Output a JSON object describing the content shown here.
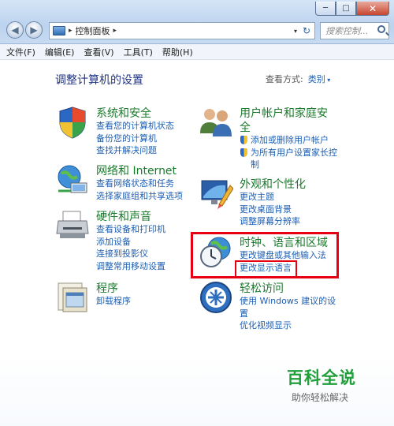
{
  "window": {
    "buttons": {
      "minimize": "─",
      "maximize": "□",
      "close": "✕"
    }
  },
  "nav": {
    "back": "◀",
    "forward": "▶"
  },
  "address": {
    "crumbs": [
      "控制面板"
    ],
    "separator": "▸",
    "dropdown": "▾",
    "refresh": "↻"
  },
  "search": {
    "placeholder": "搜索控制..."
  },
  "menu": [
    "文件(F)",
    "编辑(E)",
    "查看(V)",
    "工具(T)",
    "帮助(H)"
  ],
  "page": {
    "heading": "调整计算机的设置",
    "view_by_label": "查看方式:",
    "view_by_value": "类别"
  },
  "categories": {
    "system": {
      "title": "系统和安全",
      "links": [
        "查看您的计算机状态",
        "备份您的计算机",
        "查找并解决问题"
      ]
    },
    "network": {
      "title": "网络和 Internet",
      "links": [
        "查看网络状态和任务",
        "选择家庭组和共享选项"
      ]
    },
    "hardware": {
      "title": "硬件和声音",
      "links": [
        "查看设备和打印机",
        "添加设备",
        "连接到投影仪",
        "调整常用移动设置"
      ]
    },
    "programs": {
      "title": "程序",
      "links": [
        "卸载程序"
      ]
    },
    "users": {
      "title_line1": "用户帐户和家庭安",
      "title_line2": "全",
      "links": [
        "添加或删除用户帐户",
        "为所有用户设置家长控",
        "制"
      ]
    },
    "appearance": {
      "title": "外观和个性化",
      "links": [
        "更改主题",
        "更改桌面背景",
        "调整屏幕分辨率"
      ]
    },
    "clock": {
      "title": "时钟、语言和区域",
      "links": [
        "更改键盘或其他输入法",
        "更改显示语言"
      ]
    },
    "ease": {
      "title": "轻松访问",
      "links": [
        "使用 Windows 建议的设",
        "置",
        "优化视频显示"
      ]
    }
  },
  "watermark": {
    "title": "百科全说",
    "subtitle": "助你轻松解决"
  },
  "colors": {
    "link": "#1c5fb5",
    "category_title": "#1a7a2c",
    "heading": "#1e3287",
    "highlight": "#e60012"
  }
}
